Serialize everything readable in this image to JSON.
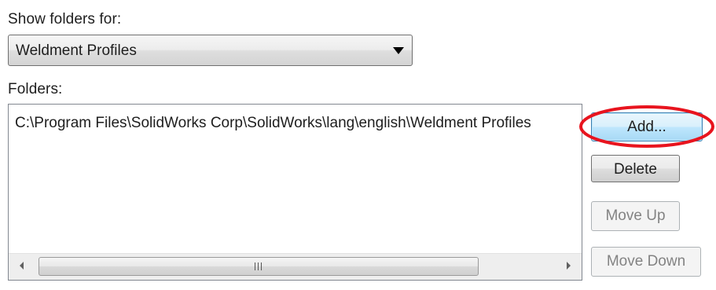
{
  "show_folders": {
    "label": "Show folders for:",
    "selected": "Weldment Profiles"
  },
  "folders": {
    "label": "Folders:",
    "items": [
      "C:\\Program Files\\SolidWorks Corp\\SolidWorks\\lang\\english\\Weldment Profiles"
    ]
  },
  "buttons": {
    "add": "Add...",
    "delete": "Delete",
    "move_up": "Move Up",
    "move_down": "Move Down"
  },
  "scrollbar": {
    "left_icon": "scroll-left-arrow",
    "right_icon": "scroll-right-arrow",
    "grip_icon": "grip"
  },
  "highlight_color": "#e8141e"
}
